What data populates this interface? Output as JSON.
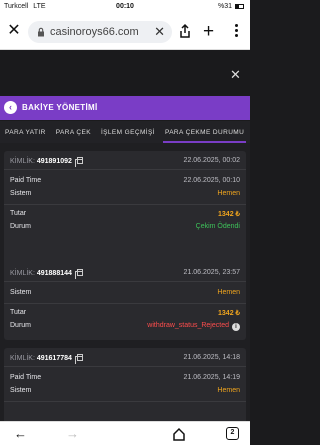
{
  "status_bar": {
    "carrier": "Turkcell",
    "network": "LTE",
    "time": "00:10",
    "battery": "%31"
  },
  "browser": {
    "url": "casinoroys66.com",
    "tab_count": "2"
  },
  "section": {
    "title": "BAKİYE YÖNETİMİ"
  },
  "tabs": [
    {
      "label": "PARA YATIR",
      "active": false
    },
    {
      "label": "PARA ÇEK",
      "active": false
    },
    {
      "label": "İŞLEM GEÇMİŞİ",
      "active": false
    },
    {
      "label": "PARA ÇEKME DURUMU",
      "active": true
    }
  ],
  "labels": {
    "kimlik": "KİMLİK:",
    "paid_time": "Paid Time",
    "sistem": "Sistem",
    "tutar": "Tutar",
    "durum": "Durum"
  },
  "withdrawals": [
    {
      "id": "491891092",
      "date": "22.06.2025, 00:02",
      "paid_time": "22.06.2025, 00:10",
      "sistem": "Hemen",
      "tutar": "1342 ₺",
      "durum": "Çekim Ödendi"
    },
    {
      "id": "491888144",
      "date": "21.06.2025, 23:57",
      "sistem": "Hemen",
      "tutar": "1342 ₺",
      "durum": "withdraw_status_Rejected"
    },
    {
      "id": "491617784",
      "date": "21.06.2025, 14:18",
      "paid_time": "21.06.2025, 14:19",
      "sistem": "Hemen"
    }
  ],
  "colors": {
    "accent": "#7a3dc6",
    "amount": "#f0a51e",
    "success": "#3ec15a",
    "error": "#ff4d4d"
  }
}
